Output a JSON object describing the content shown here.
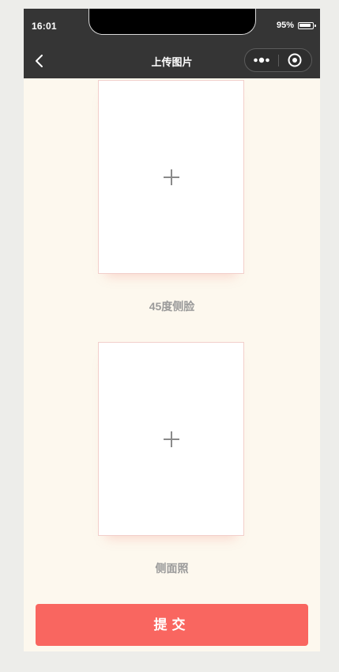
{
  "status_bar": {
    "time": "16:01",
    "battery_percent": "95%",
    "battery_level": 0.95
  },
  "nav": {
    "title": "上传图片",
    "back_icon": "chevron-left-icon",
    "more_icon": "more-dots-icon",
    "close_icon": "target-close-icon"
  },
  "uploads": [
    {
      "label": "45度侧脸",
      "icon": "plus-icon"
    },
    {
      "label": "侧面照",
      "icon": "plus-icon"
    }
  ],
  "submit": {
    "label": "提交"
  },
  "colors": {
    "nav_background": "#353535",
    "page_background": "#fdf8ee",
    "accent": "#f96660",
    "label_text": "#9a9a9a"
  }
}
